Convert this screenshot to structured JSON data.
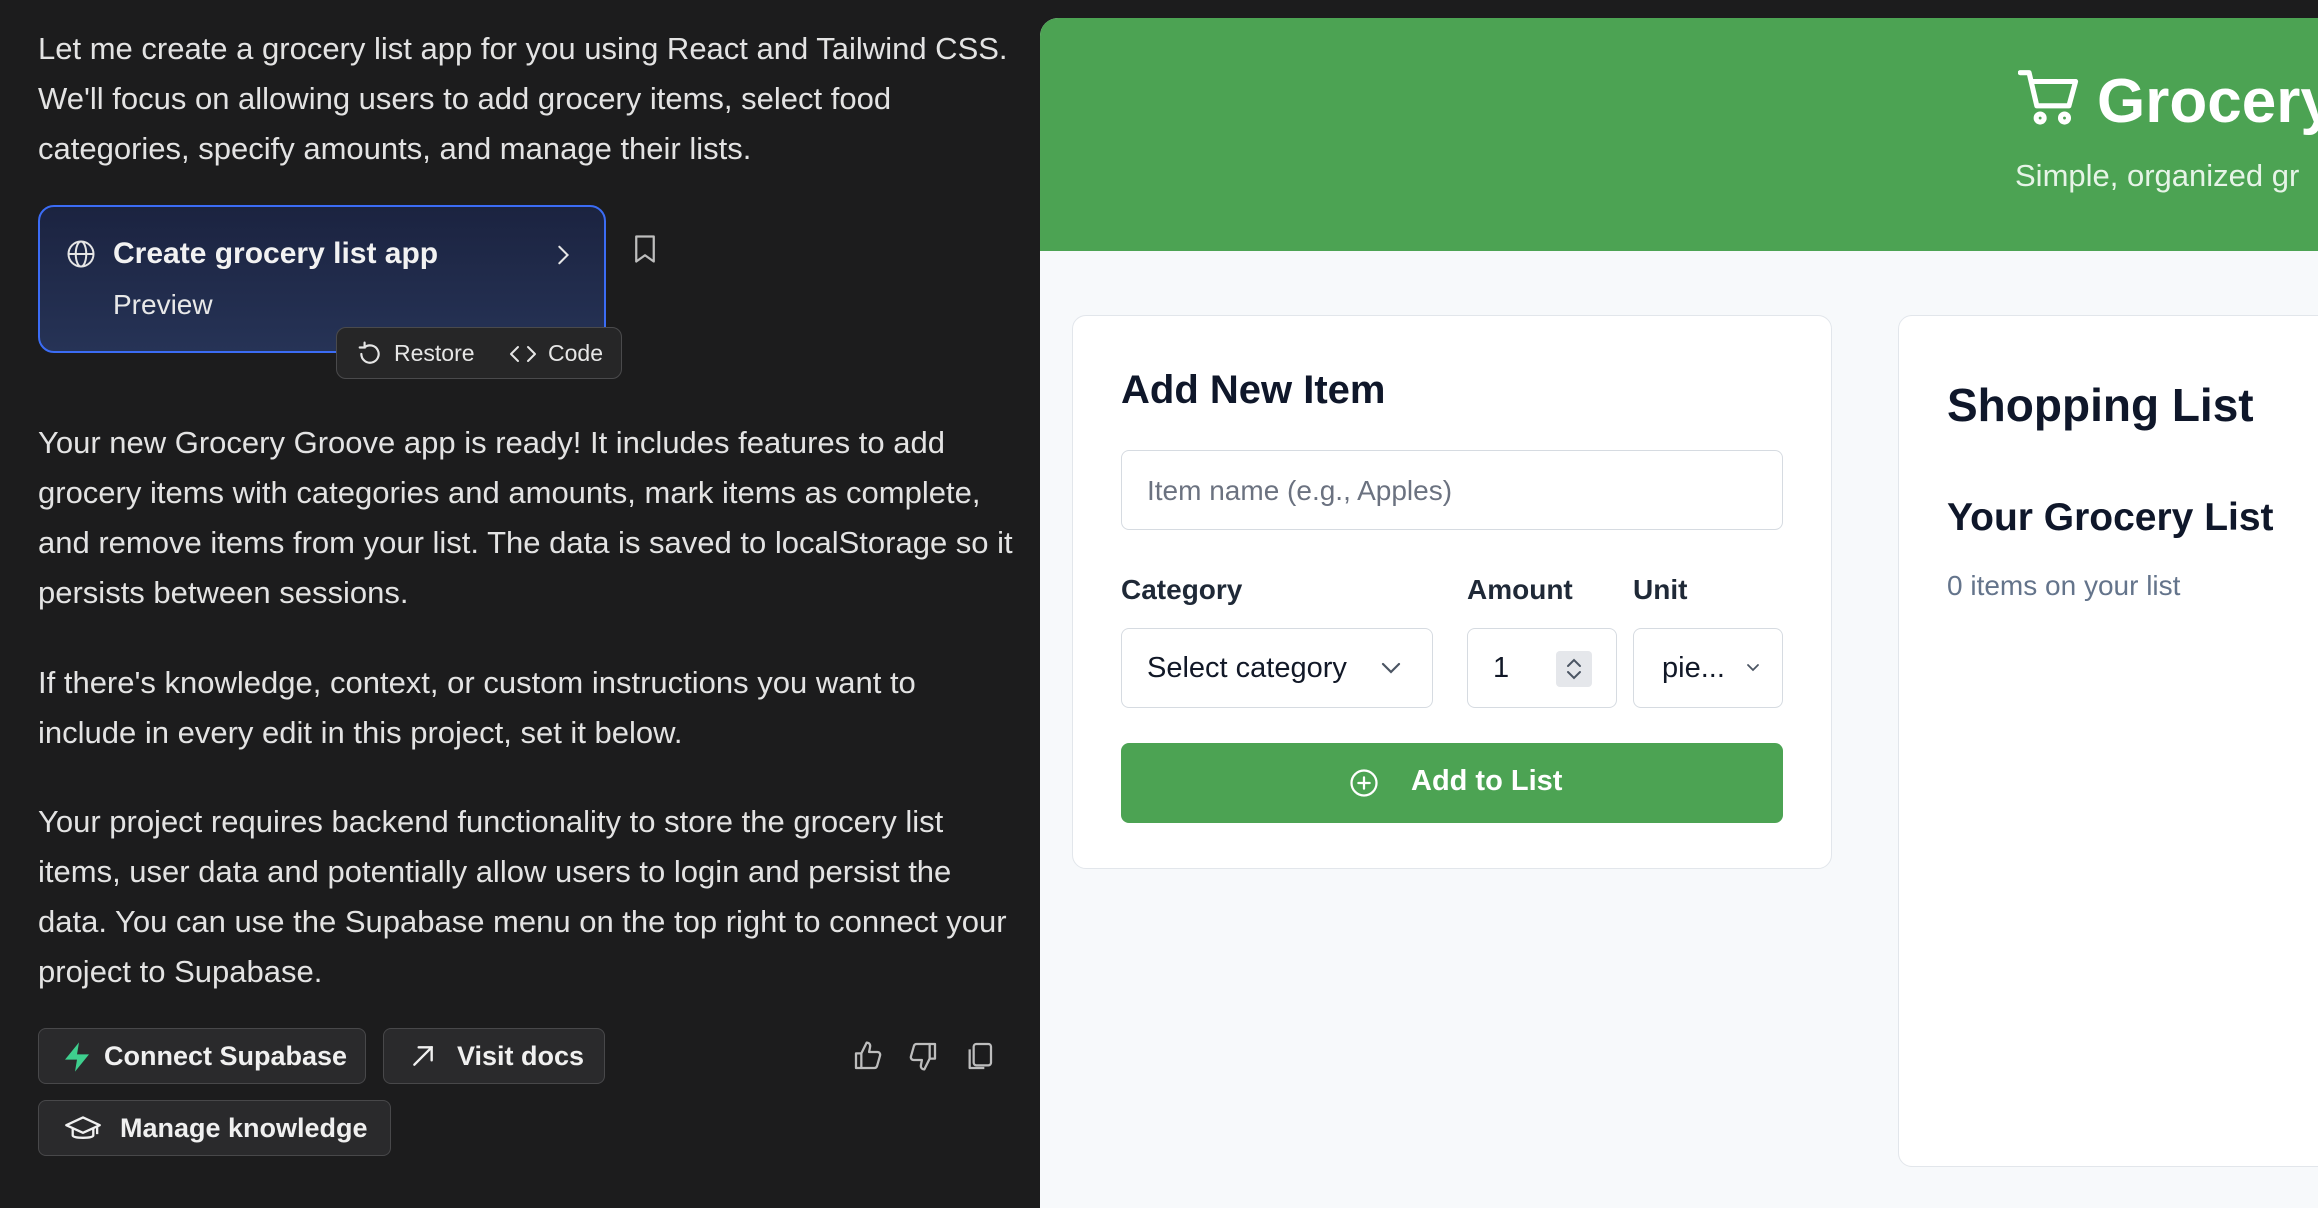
{
  "chat": {
    "intro": "Let me create a grocery list app for you using React and Tailwind CSS. We'll focus on allowing users to add grocery items, select food categories, specify amounts, and manage their lists.",
    "artifact": {
      "title": "Create grocery list app",
      "subtitle": "Preview"
    },
    "restore_label": "Restore",
    "code_label": "Code",
    "ready": "Your new Grocery Groove app is ready! It includes features to add grocery items with categories and amounts, mark items as complete, and remove items from your list. The data is saved to localStorage so it persists between sessions.",
    "knowledge": "If there's knowledge, context, or custom instructions you want to include in every edit in this project, set it below.",
    "backend": "Your project requires backend functionality to store the grocery list items, user data and potentially allow users to login and persist the data. You can use the Supabase menu on the top right to connect your project to Supabase.",
    "buttons": {
      "connect_supabase": "Connect Supabase",
      "visit_docs": "Visit docs",
      "manage_knowledge": "Manage knowledge"
    },
    "icons": [
      "globe-icon",
      "chevron-right-icon",
      "bookmark-icon",
      "restore-icon",
      "code-icon",
      "supabase-icon",
      "arrow-up-right-icon",
      "graduation-cap-icon",
      "thumbs-up-icon",
      "thumbs-down-icon",
      "copy-icon"
    ]
  },
  "preview": {
    "header": {
      "title": "Grocery",
      "tagline": "Simple, organized gr",
      "bg_color": "#4ca353"
    },
    "add_card": {
      "title": "Add New Item",
      "name_placeholder": "Item name (e.g., Apples)",
      "category_label": "Category",
      "category_value": "Select category",
      "amount_label": "Amount",
      "amount_value": "1",
      "unit_label": "Unit",
      "unit_value": "pie...",
      "add_button": "Add to List"
    },
    "list_card": {
      "title": "Shopping List",
      "subtitle": "Your Grocery List",
      "count": "0 items on your list"
    }
  },
  "colors": {
    "accent": "#4ca353",
    "chat_bg": "#1c1c1d",
    "artifact_border": "#3b6cf5"
  }
}
